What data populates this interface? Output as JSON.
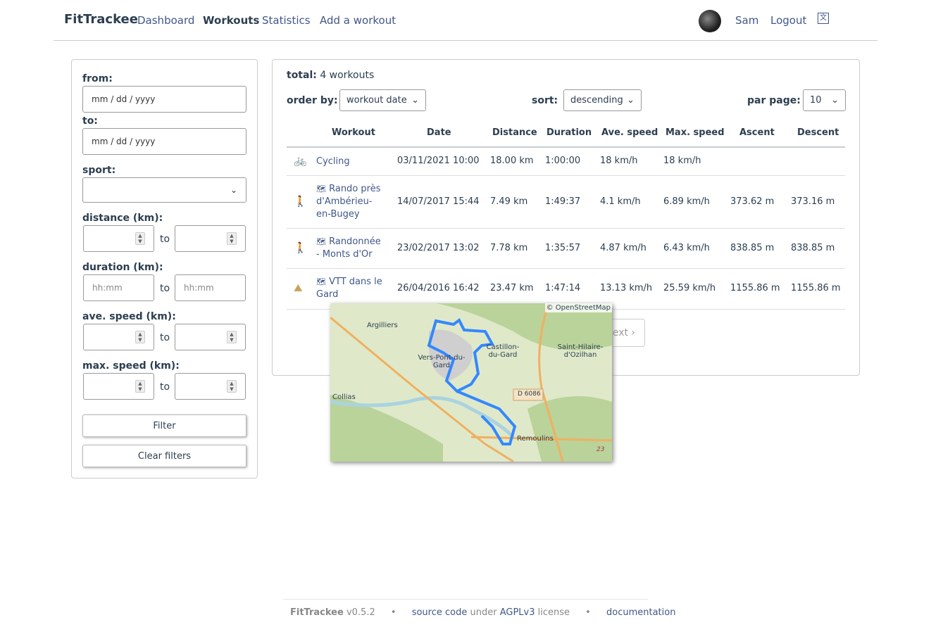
{
  "nav": {
    "brand": "FitTrackee",
    "items": [
      "Dashboard",
      "Workouts",
      "Statistics",
      "Add a workout"
    ],
    "user": "Sam",
    "logout": "Logout",
    "language_icon": "translate-icon"
  },
  "filters": {
    "from_label": "from:",
    "from_placeholder": "mm / dd / yyyy",
    "to_label": "to:",
    "to_placeholder": "mm / dd / yyyy",
    "sport_label": "sport:",
    "sport_value": "",
    "distance_label": "distance (km):",
    "duration_label": "duration (km):",
    "duration_placeholder": "hh:mm",
    "ave_speed_label": "ave. speed (km):",
    "max_speed_label": "max. speed (km):",
    "to_word": "to",
    "filter_button": "Filter",
    "clear_button": "Clear filters"
  },
  "summary": {
    "total_label": "total:",
    "total_value": "4 workouts",
    "order_by_label": "order by:",
    "order_by_value": "workout date",
    "sort_label": "sort:",
    "sort_value": "descending",
    "per_page_label": "par page:",
    "per_page_value": "10"
  },
  "table": {
    "headers": [
      "Workout",
      "Date",
      "Distance",
      "Duration",
      "Ave. speed",
      "Max. speed",
      "Ascent",
      "Descent"
    ],
    "rows": [
      {
        "sport": "cycling",
        "color": "#4c9a6a",
        "title": "Cycling",
        "date": "03/11/2021 10:00",
        "distance": "18.00 km",
        "duration": "1:00:00",
        "ave": "18 km/h",
        "max": "18 km/h",
        "ascent": "",
        "descent": ""
      },
      {
        "sport": "hiking",
        "color": "#c0615b",
        "title": "Rando près d'Ambérieu-en-Bugey",
        "date": "14/07/2017 15:44",
        "distance": "7.49 km",
        "duration": "1:49:37",
        "ave": "4.1 km/h",
        "max": "6.89 km/h",
        "ascent": "373.62 m",
        "descent": "373.16 m"
      },
      {
        "sport": "hiking",
        "color": "#c0615b",
        "title": "Randonnée - Monts d'Or",
        "date": "23/02/2017 13:02",
        "distance": "7.78 km",
        "duration": "1:35:57",
        "ave": "4.87 km/h",
        "max": "6.43 km/h",
        "ascent": "838.85 m",
        "descent": "838.85 m"
      },
      {
        "sport": "mountain-biking",
        "color": "#c9a35a",
        "title": "VTT dans le Gard",
        "date": "26/04/2016 16:42",
        "distance": "23.47 km",
        "duration": "1:47:14",
        "ave": "13.13 km/h",
        "max": "25.59 km/h",
        "ascent": "1155.86 m",
        "descent": "1155.86 m"
      }
    ]
  },
  "pagination": {
    "next": "next"
  },
  "map": {
    "attribution": "© OpenStreetMap",
    "places": [
      "Argilliers",
      "Castillon-du-Gard",
      "Saint-Hilaire-d'Ozilhan",
      "Vers-Pont-du-Gard",
      "Collias",
      "Remoulins",
      "D 6086",
      "23"
    ],
    "track_color": "#3388ff"
  },
  "footer": {
    "brand": "FitTrackee",
    "version": "v0.5.2",
    "source": "source code",
    "under": "under",
    "license_name": "AGPLv3",
    "license": "license",
    "docs": "documentation",
    "sep": "•"
  }
}
